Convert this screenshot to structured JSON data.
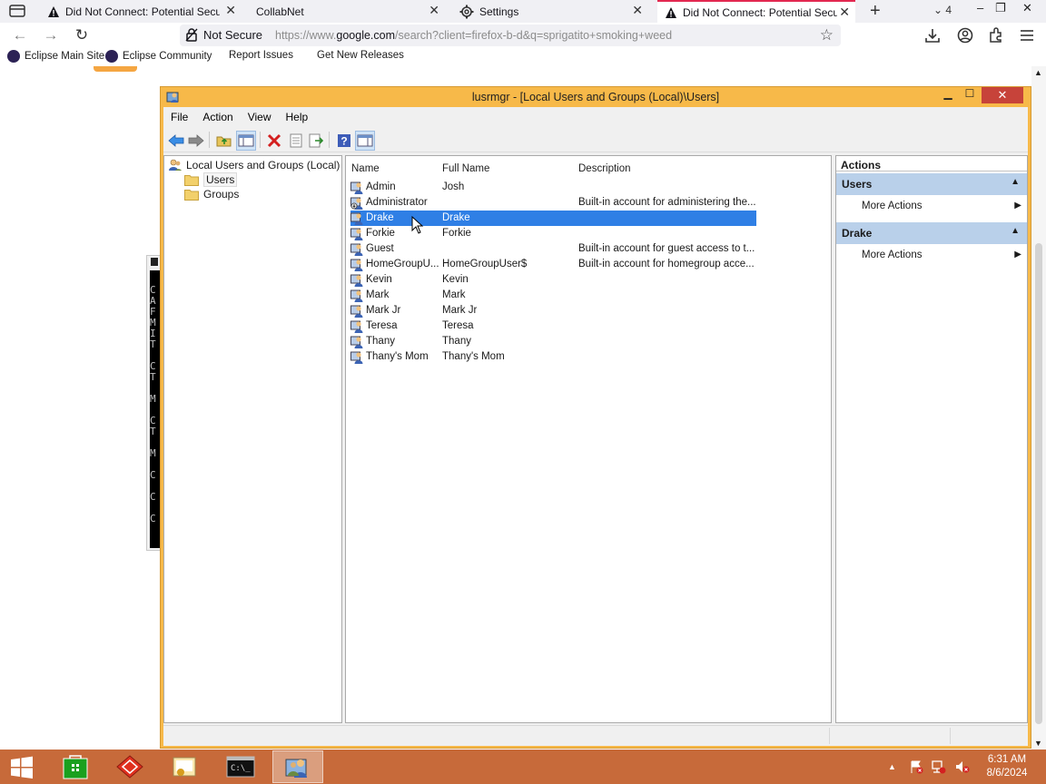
{
  "browser": {
    "tabs": [
      {
        "title": "Did Not Connect: Potential Security Issue",
        "icon": "warning-icon"
      },
      {
        "title": "CollabNet",
        "icon": ""
      },
      {
        "title": "Settings",
        "icon": "gear-icon"
      },
      {
        "title": "Did Not Connect: Potential Security Issue",
        "icon": "warning-icon",
        "active": true
      }
    ],
    "tab_count": "4",
    "url": {
      "security_label": "Not Secure",
      "prefix": "https://www.",
      "domain": "google.com",
      "suffix": "/search?client=firefox-b-d&q=sprigatito+smoking+weed"
    },
    "bookmarks": [
      "Eclipse Main Site",
      "Eclipse Community",
      "Report Issues",
      "Get New Releases"
    ]
  },
  "mmc": {
    "title": "lusrmgr - [Local Users and Groups (Local)\\Users]",
    "menu": [
      "File",
      "Action",
      "View",
      "Help"
    ],
    "tree": {
      "root": "Local Users and Groups (Local)",
      "children": [
        "Users",
        "Groups"
      ],
      "selected": "Users"
    },
    "columns": [
      "Name",
      "Full Name",
      "Description"
    ],
    "users": [
      {
        "name": "Admin",
        "full_name": "Josh",
        "description": ""
      },
      {
        "name": "Administrator",
        "full_name": "",
        "description": "Built-in account for administering the..."
      },
      {
        "name": "Drake",
        "full_name": "Drake",
        "description": ""
      },
      {
        "name": "Forkie",
        "full_name": "Forkie",
        "description": ""
      },
      {
        "name": "Guest",
        "full_name": "",
        "description": "Built-in account for guest access to t..."
      },
      {
        "name": "HomeGroupU...",
        "full_name": "HomeGroupUser$",
        "description": "Built-in account for homegroup acce..."
      },
      {
        "name": "Kevin",
        "full_name": "Kevin",
        "description": ""
      },
      {
        "name": "Mark",
        "full_name": "Mark",
        "description": ""
      },
      {
        "name": "Mark Jr",
        "full_name": "Mark Jr",
        "description": ""
      },
      {
        "name": "Teresa",
        "full_name": "Teresa",
        "description": ""
      },
      {
        "name": "Thany",
        "full_name": "Thany",
        "description": ""
      },
      {
        "name": "Thany's Mom",
        "full_name": "Thany's Mom",
        "description": ""
      }
    ],
    "selected_user": "Drake",
    "actions": {
      "header": "Actions",
      "groups": [
        {
          "label": "Users",
          "items": [
            "More Actions"
          ]
        },
        {
          "label": "Drake",
          "items": [
            "More Actions"
          ]
        }
      ]
    }
  },
  "console_glyphs": [
    "C",
    "A",
    "F",
    "M",
    "I",
    "T",
    "",
    "C",
    "T",
    "",
    "M",
    "",
    "C",
    "T",
    "",
    "M",
    "",
    "C",
    "",
    "C",
    "",
    "C"
  ],
  "taskbar": {
    "clock_time": "6:31 AM",
    "clock_date": "8/6/2024",
    "cmd_label": "C:\\_"
  },
  "colors": {
    "taskbar": "#c76a3a",
    "window_frame": "#f7b949",
    "selection": "#2f7fe5",
    "close_button": "#c7433a",
    "action_group": "#b9d0ea"
  }
}
